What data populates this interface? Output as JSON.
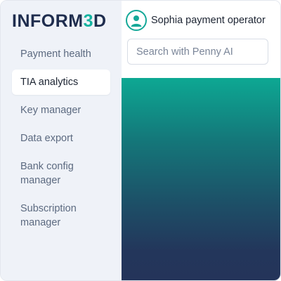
{
  "logo": {
    "prefix": "INFORM",
    "accent": "3",
    "suffix": "D"
  },
  "sidebar": {
    "items": [
      {
        "label": "Payment health"
      },
      {
        "label": "TIA analytics"
      },
      {
        "label": "Key manager"
      },
      {
        "label": "Data export"
      },
      {
        "label": "Bank config manager"
      },
      {
        "label": "Subscription manager"
      }
    ],
    "active_index": 1
  },
  "header": {
    "user_name": "Sophia payment operator",
    "avatar_icon": "user-icon"
  },
  "search": {
    "placeholder": "Search with Penny AI",
    "value": ""
  },
  "colors": {
    "brand_dark": "#1f2d4e",
    "brand_accent": "#14b3a0",
    "sidebar_bg": "#eff2f8",
    "gradient_top": "#0da893",
    "gradient_bottom": "#24345a"
  }
}
